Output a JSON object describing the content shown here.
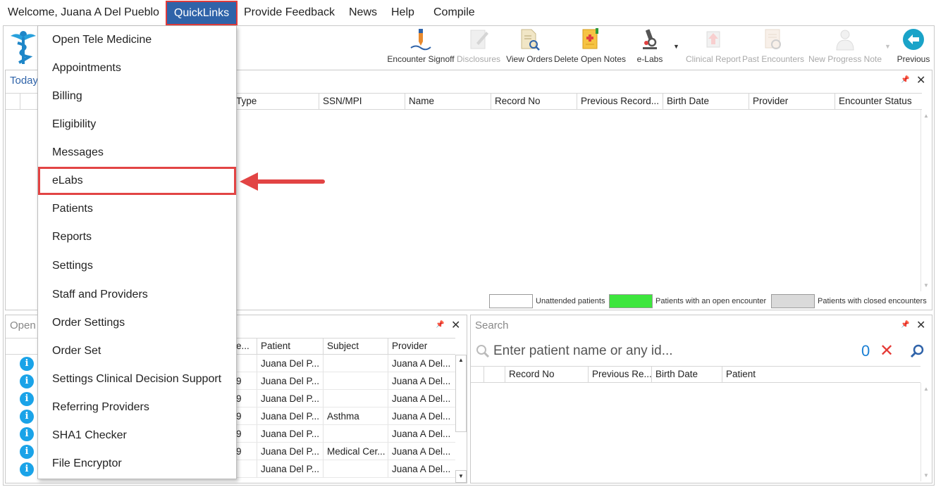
{
  "menubar": {
    "welcome": "Welcome, Juana A Del Pueblo",
    "quicklinks": "QuickLinks",
    "feedback": "Provide Feedback",
    "news": "News",
    "help": "Help",
    "compile": "Compile"
  },
  "quicklinks_menu": [
    "Open Tele Medicine",
    "Appointments",
    "Billing",
    "Eligibility",
    "Messages",
    "eLabs",
    "Patients",
    "Reports",
    "Settings",
    "Staff and Providers",
    "Order Settings",
    "Order Set",
    "Settings Clinical Decision Support",
    "Referring Providers",
    "SHA1 Checker",
    "File Encryptor"
  ],
  "highlighted_item": "eLabs",
  "toolbar": {
    "encounter_signoff": "Encounter Signoff",
    "disclosures": "Disclosures",
    "view_orders": "View Orders",
    "delete_open_notes": "Delete Open Notes",
    "elabs": "e-Labs",
    "clinical_report": "Clinical Report",
    "past_encounters": "Past Encounters",
    "new_progress_note": "New Progress Note",
    "previous": "Previous"
  },
  "today_panel": {
    "title": "Today",
    "columns": [
      "Type",
      "SSN/MPI",
      "Name",
      "Record No",
      "Previous Record...",
      "Birth Date",
      "Provider",
      "Encounter Status"
    ]
  },
  "legend": {
    "unattended": "Unattended patients",
    "open": "Patients with an open encounter",
    "closed": "Patients with closed encounters",
    "open_color": "#3de63d",
    "closed_color": "#dadada"
  },
  "open_panel": {
    "title": "Open",
    "columns": [
      "e...",
      "Patient",
      "Subject",
      "Provider"
    ],
    "rows": [
      {
        "date": "",
        "patient": "Juana Del P...",
        "subject": "",
        "provider": "Juana A Del..."
      },
      {
        "date": "9",
        "patient": "Juana Del P...",
        "subject": "",
        "provider": "Juana A Del..."
      },
      {
        "date": "9",
        "patient": "Juana Del P...",
        "subject": "",
        "provider": "Juana A Del..."
      },
      {
        "date": "9",
        "patient": "Juana Del P...",
        "subject": "Asthma",
        "provider": "Juana A Del..."
      },
      {
        "date": "9",
        "patient": "Juana Del P...",
        "subject": "",
        "provider": "Juana A Del..."
      },
      {
        "date": "9",
        "patient": "Juana Del P...",
        "subject": "Medical Cer...",
        "provider": "Juana A Del..."
      },
      {
        "date": "",
        "patient": "Juana Del P...",
        "subject": "",
        "provider": "Juana A Del..."
      }
    ]
  },
  "search_panel": {
    "title": "Search",
    "placeholder": "Enter patient name or any id...",
    "count": "0",
    "columns": [
      "Record No",
      "Previous Re...",
      "Birth Date",
      "Patient"
    ]
  }
}
